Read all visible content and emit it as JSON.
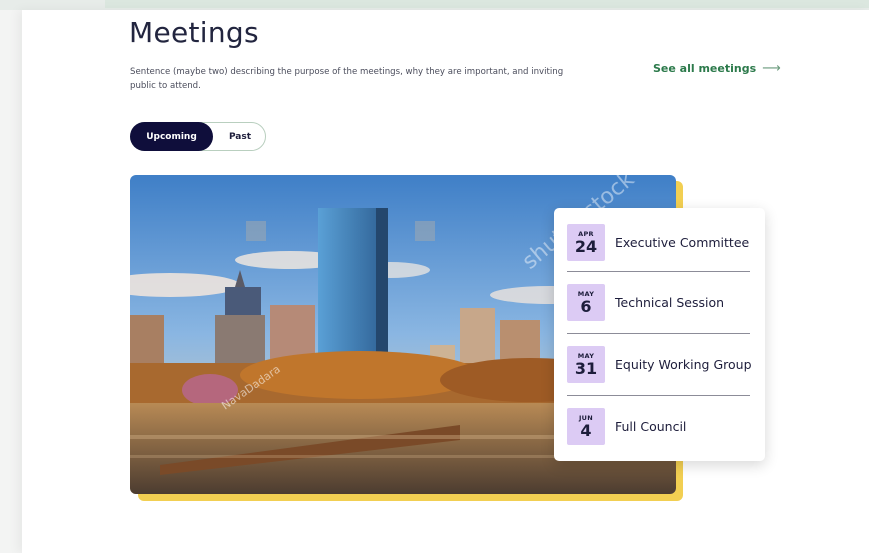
{
  "header": {
    "title": "Meetings",
    "description": "Sentence (maybe two) describing the purpose of the meetings, why they are important, and inviting public to attend.",
    "see_all_label": "See all meetings",
    "see_all_icon": "arrow-right-icon"
  },
  "toggle": {
    "upcoming_label": "Upcoming",
    "past_label": "Past",
    "selected": "Upcoming"
  },
  "image": {
    "watermarks": [
      "shutterstock",
      "NavaDadara"
    ]
  },
  "meetings": [
    {
      "month": "APR",
      "day": "24",
      "name": "Executive Committee"
    },
    {
      "month": "MAY",
      "day": "6",
      "name": "Technical Session"
    },
    {
      "month": "MAY",
      "day": "31",
      "name": "Equity Working Group"
    },
    {
      "month": "JUN",
      "day": "4",
      "name": "Full Council"
    }
  ],
  "colors": {
    "toggle_active": "#0f0e3b",
    "link_green": "#2c7a4b",
    "date_badge": "#dccbf4",
    "accent_yellow": "#f2cf52"
  }
}
